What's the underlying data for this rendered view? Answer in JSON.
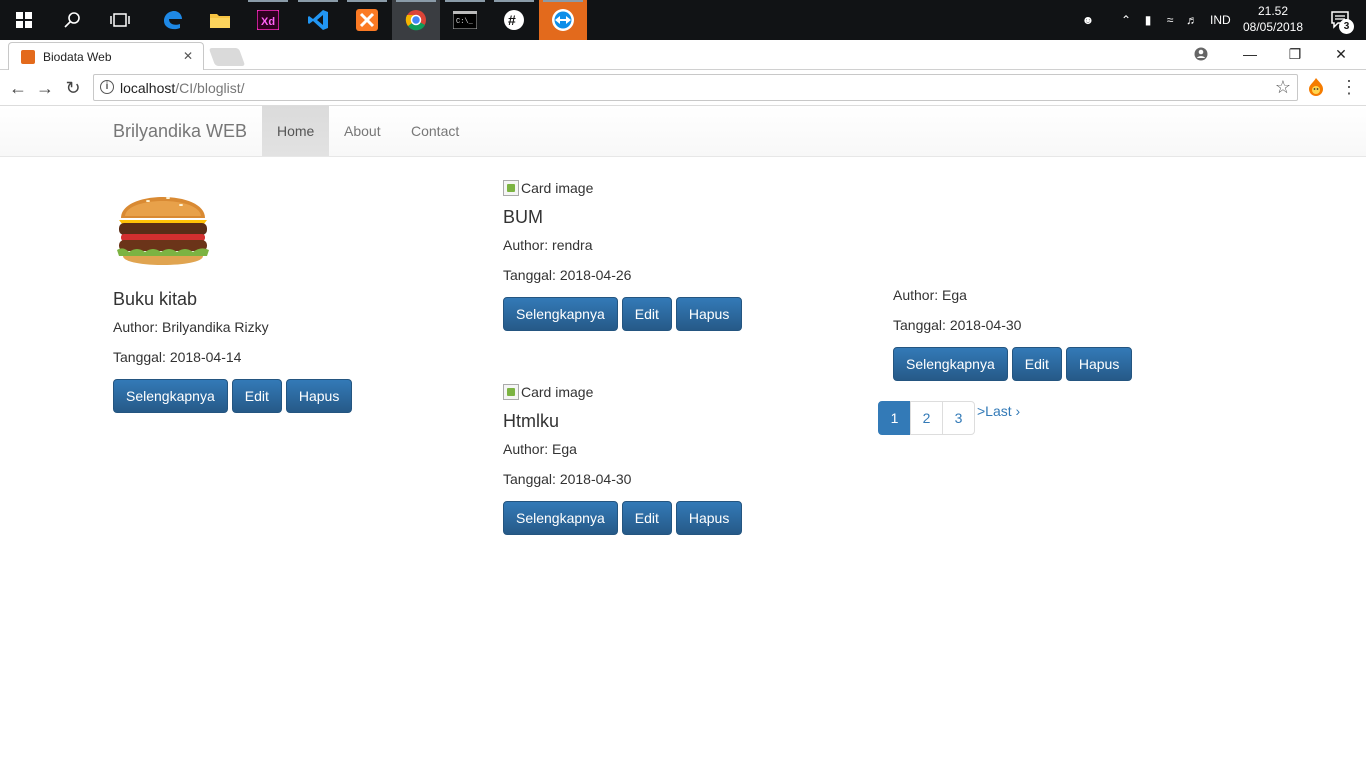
{
  "taskbar": {
    "tray_lang": "IND",
    "time": "21.52",
    "date": "08/05/2018",
    "notifications": "3"
  },
  "browser": {
    "tab_title": "Biodata Web",
    "url_host": "localhost",
    "url_path": "/CI/bloglist/"
  },
  "navbar": {
    "brand": "Brilyandika WEB",
    "links": [
      "Home",
      "About",
      "Contact"
    ]
  },
  "posts": [
    {
      "img_alt": "",
      "title": "Buku kitab",
      "author": "Author: Brilyandika Rizky",
      "date": "Tanggal: 2018-04-14"
    },
    {
      "img_alt": "Card image",
      "title": "BUM",
      "author": "Author: rendra",
      "date": "Tanggal: 2018-04-26"
    },
    {
      "img_alt": "Card image",
      "title": "Htmlku",
      "author": "Author: Ega",
      "date": "Tanggal: 2018-04-30"
    },
    {
      "img_alt": "",
      "title": "",
      "author": "Author: Ega",
      "date": "Tanggal: 2018-04-30"
    }
  ],
  "buttons": {
    "more": "Selengkapnya",
    "edit": "Edit",
    "delete": "Hapus"
  },
  "pagination": {
    "pages": [
      "1",
      "2",
      "3"
    ],
    "last": ">Last ›",
    "current": "1"
  },
  "colors": {
    "primary": "#337ab7",
    "taskbar": "#111315",
    "xampp": "#e36a1c"
  }
}
